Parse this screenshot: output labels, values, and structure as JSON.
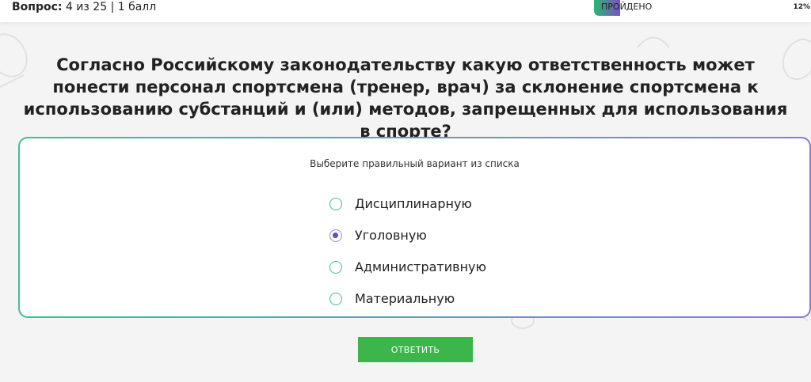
{
  "header": {
    "question_label": "Вопрос:",
    "question_info": "4 из 25 | 1 балл",
    "progress_label": "ПРОЙДЕНО",
    "progress_percent_text": "12%",
    "progress_value": 0.12,
    "progress_gradient": [
      "#2bb673",
      "#7b4fc9"
    ]
  },
  "question": {
    "text": "Согласно Российскому законодательству какую ответственность может понести персонал спортсмена (тренер, врач) за склонение спортсмена к использованию субстанций и (или) методов, запрещенных для использования в спорте?"
  },
  "answers": {
    "instruction": "Выберите правильный вариант из списка",
    "options": [
      {
        "label": "Дисциплинарную",
        "selected": false
      },
      {
        "label": "Уголовную",
        "selected": true
      },
      {
        "label": "Административную",
        "selected": false
      },
      {
        "label": "Материальную",
        "selected": false
      }
    ]
  },
  "submit": {
    "label": "ОТВЕТИТЬ",
    "color": "#3cb54a"
  },
  "colors": {
    "radio_border": "#3fbf93",
    "radio_selected": "#5a4fc9",
    "card_gradient": [
      "#3fbf93",
      "#8c7ad6"
    ]
  }
}
